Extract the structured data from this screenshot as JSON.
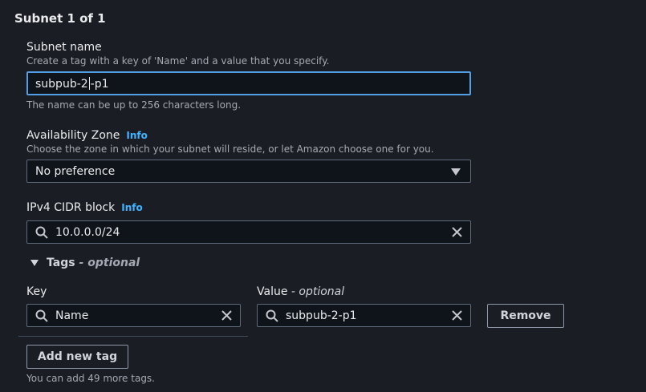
{
  "section": {
    "title": "Subnet 1 of 1"
  },
  "subnet_name": {
    "label": "Subnet name",
    "description": "Create a tag with a key of 'Name' and a value that you specify.",
    "value_before_caret": "subpub-2",
    "value_after_caret": "-p1",
    "hint": "The name can be up to 256 characters long."
  },
  "availability_zone": {
    "label": "Availability Zone",
    "info": "Info",
    "description": "Choose the zone in which your subnet will reside, or let Amazon choose one for you.",
    "selected": "No preference"
  },
  "cidr": {
    "label": "IPv4 CIDR block",
    "info": "Info",
    "value": "10.0.0.0/24"
  },
  "tags": {
    "toggle_label": "Tags",
    "toggle_optional": "- optional",
    "key_label": "Key",
    "value_label": "Value",
    "value_optional": "- optional",
    "rows": [
      {
        "key": "Name",
        "value": "subpub-2-p1",
        "remove_label": "Remove"
      }
    ],
    "add_button": "Add new tag",
    "remaining_hint": "You can add 49 more tags."
  },
  "colors": {
    "background": "#1b1d24",
    "focus_border": "#539fe5",
    "link": "#42b4ff"
  },
  "icons": [
    "search-icon",
    "clear-icon",
    "caret-down-icon",
    "triangle-down-icon"
  ]
}
